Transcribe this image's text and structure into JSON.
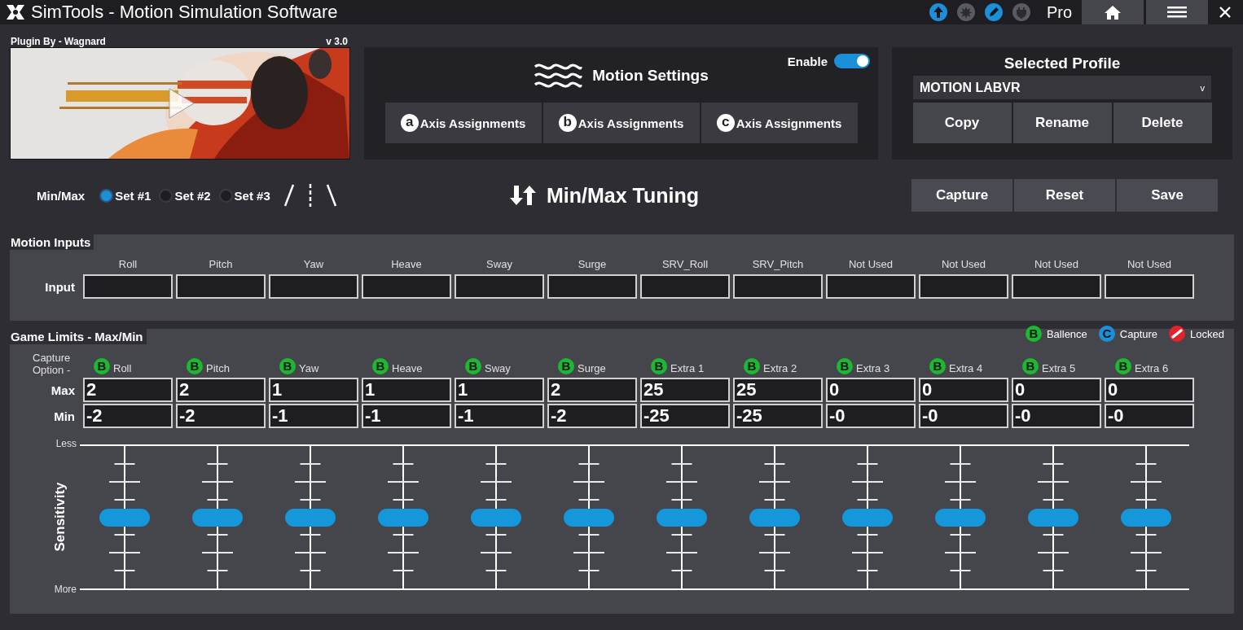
{
  "window": {
    "title": "SimTools - Motion Simulation Software",
    "edition": "Pro",
    "status_icons": [
      {
        "kind": "upload",
        "active": true
      },
      {
        "kind": "burst",
        "active": false
      },
      {
        "kind": "edit",
        "active": true
      },
      {
        "kind": "plug",
        "active": false
      }
    ]
  },
  "plugin": {
    "author": "Plugin By - Wagnard",
    "version": "v 3.0"
  },
  "motion_settings": {
    "title": "Motion Settings",
    "enable_label": "Enable",
    "enabled": true,
    "axis_buttons": [
      {
        "letter": "a",
        "label": "Axis Assignments"
      },
      {
        "letter": "b",
        "label": "Axis Assignments"
      },
      {
        "letter": "c",
        "label": "Axis Assignments"
      }
    ]
  },
  "profile": {
    "title": "Selected Profile",
    "value": "MOTION LABVR",
    "caret": "v",
    "buttons": [
      "Copy",
      "Rename",
      "Delete"
    ]
  },
  "tuning": {
    "label": "Min/Max",
    "sets": [
      {
        "label": "Set #1",
        "selected": true
      },
      {
        "label": "Set #2",
        "selected": false
      },
      {
        "label": "Set #3",
        "selected": false
      }
    ],
    "title": "Min/Max Tuning",
    "buttons": [
      "Capture",
      "Reset",
      "Save"
    ]
  },
  "motion_inputs": {
    "title": "Motion Inputs",
    "row_label": "Input",
    "columns": [
      "Roll",
      "Pitch",
      "Yaw",
      "Heave",
      "Sway",
      "Surge",
      "SRV_Roll",
      "SRV_Pitch",
      "Not Used",
      "Not Used",
      "Not Used",
      "Not Used"
    ]
  },
  "game_limits": {
    "title": "Game Limits - Max/Min",
    "legend": [
      {
        "kind": "balance",
        "letter": "B",
        "label": "Ballence",
        "color": "#1cb832"
      },
      {
        "kind": "capture",
        "letter": "C",
        "label": "Capture",
        "color": "#1b8fd8"
      },
      {
        "kind": "locked",
        "label": "Locked",
        "color": "#e3242b"
      }
    ],
    "capture_label": "Capture Option -",
    "max_label": "Max",
    "min_label": "Min",
    "axes": [
      {
        "name": "Roll",
        "option": "B",
        "color": "#1cb832",
        "max": "2",
        "min": "-2",
        "level": 0.5
      },
      {
        "name": "Pitch",
        "option": "B",
        "color": "#1cb832",
        "max": "2",
        "min": "-2",
        "level": 0.5
      },
      {
        "name": "Yaw",
        "option": "B",
        "color": "#1cb832",
        "max": "1",
        "min": "-1",
        "level": 0.5
      },
      {
        "name": "Heave",
        "option": "B",
        "color": "#1cb832",
        "max": "1",
        "min": "-1",
        "level": 0.5
      },
      {
        "name": "Sway",
        "option": "B",
        "color": "#1cb832",
        "max": "1",
        "min": "-1",
        "level": 0.5
      },
      {
        "name": "Surge",
        "option": "B",
        "color": "#1cb832",
        "max": "2",
        "min": "-2",
        "level": 0.5
      },
      {
        "name": "Extra 1",
        "option": "B",
        "color": "#1cb832",
        "max": "25",
        "min": "-25",
        "level": 0.5
      },
      {
        "name": "Extra 2",
        "option": "B",
        "color": "#1cb832",
        "max": "25",
        "min": "-25",
        "level": 0.5
      },
      {
        "name": "Extra 3",
        "option": "B",
        "color": "#1cb832",
        "max": "0",
        "min": "-0",
        "level": 0.5
      },
      {
        "name": "Extra 4",
        "option": "B",
        "color": "#1cb832",
        "max": "0",
        "min": "-0",
        "level": 0.5
      },
      {
        "name": "Extra 5",
        "option": "B",
        "color": "#1cb832",
        "max": "0",
        "min": "-0",
        "level": 0.5
      },
      {
        "name": "Extra 6",
        "option": "B",
        "color": "#1cb832",
        "max": "0",
        "min": "-0",
        "level": 0.5
      }
    ],
    "scale": {
      "top": "Less",
      "bottom": "More",
      "axis": "Sensitivity"
    }
  }
}
